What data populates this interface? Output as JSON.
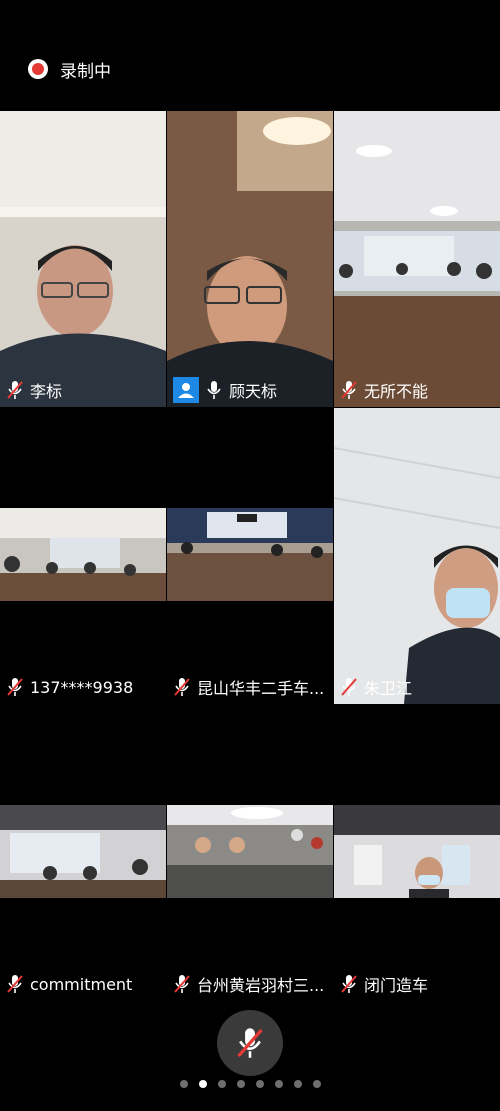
{
  "status": {
    "recording_label": "录制中"
  },
  "participants": [
    {
      "name": "李标",
      "muted": true
    },
    {
      "name": "顾天标",
      "muted": false,
      "avatar": true,
      "speaking": true
    },
    {
      "name": "无所不能",
      "muted": true
    },
    {
      "name": "137****9938",
      "muted": true
    },
    {
      "name": "昆山华丰二手车...",
      "muted": true
    },
    {
      "name": "朱卫江",
      "muted": true
    },
    {
      "name": "commitment",
      "muted": true
    },
    {
      "name": "台州黄岩羽村三...",
      "muted": true
    },
    {
      "name": "闭门造车",
      "muted": true
    }
  ],
  "controls": {
    "mic_button": "mic-muted-icon"
  },
  "pager": {
    "pages": 8,
    "active_page": 2
  },
  "colors": {
    "record": "#e53935",
    "speaking_border": "#2bbf62",
    "avatar": "#1e88e5",
    "mute_slash": "#e53935"
  }
}
